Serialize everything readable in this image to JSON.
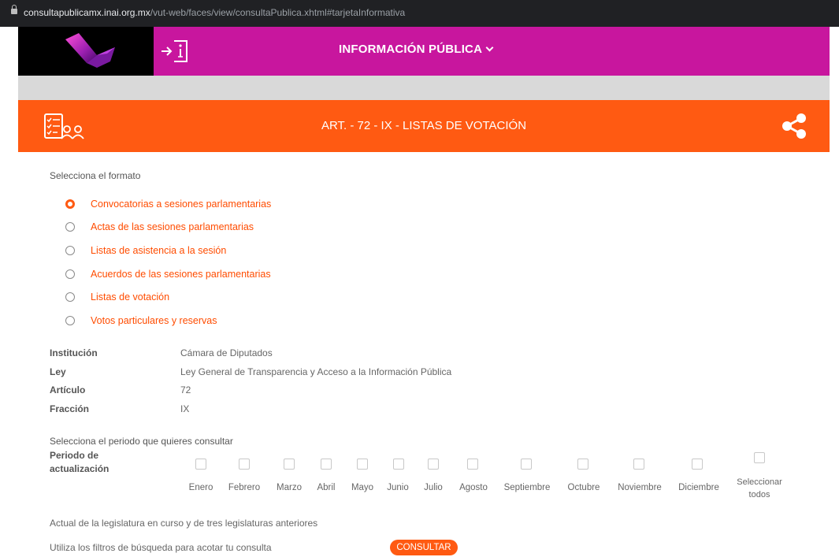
{
  "browser": {
    "url_host": "consultapublicamx.inai.org.mx",
    "url_path": "/vut-web/faces/view/consultaPublica.xhtml#tarjetaInformativa"
  },
  "header": {
    "nav_title": "INFORMACIÓN PÚBLICA",
    "brand_color": "#c8169e"
  },
  "banner": {
    "title": "ART. - 72 - IX - LISTAS DE VOTACIÓN",
    "color": "#ff5a12",
    "left_icon": "checklist-people-icon",
    "right_icon": "share-icon"
  },
  "format_section": {
    "label": "Selecciona el formato",
    "options": [
      {
        "label": "Convocatorias a sesiones parlamentarias",
        "checked": true
      },
      {
        "label": "Actas de las sesiones parlamentarias",
        "checked": false
      },
      {
        "label": "Listas de asistencia a la sesión",
        "checked": false
      },
      {
        "label": "Acuerdos de las sesiones parlamentarias",
        "checked": false
      },
      {
        "label": "Listas de votación",
        "checked": false
      },
      {
        "label": "Votos particulares y reservas",
        "checked": false
      }
    ]
  },
  "info": [
    {
      "key": "Institución",
      "value": "Cámara de Diputados"
    },
    {
      "key": "Ley",
      "value": "Ley General de Transparencia y Acceso a la Información Pública"
    },
    {
      "key": "Artículo",
      "value": "72"
    },
    {
      "key": "Fracción",
      "value": "IX"
    }
  ],
  "period": {
    "label": "Selecciona el periodo que quieres consultar",
    "title": "Periodo de actualización",
    "months": [
      "Enero",
      "Febrero",
      "Marzo",
      "Abril",
      "Mayo",
      "Junio",
      "Julio",
      "Agosto",
      "Septiembre",
      "Octubre",
      "Noviembre",
      "Diciembre"
    ],
    "select_all": "Seleccionar todos"
  },
  "note_legislature": "Actual de la legislatura en curso y de tres legislaturas anteriores",
  "note_filters": "Utiliza los filtros de búsqueda para acotar tu consulta",
  "consult_button": "CONSULTAR"
}
